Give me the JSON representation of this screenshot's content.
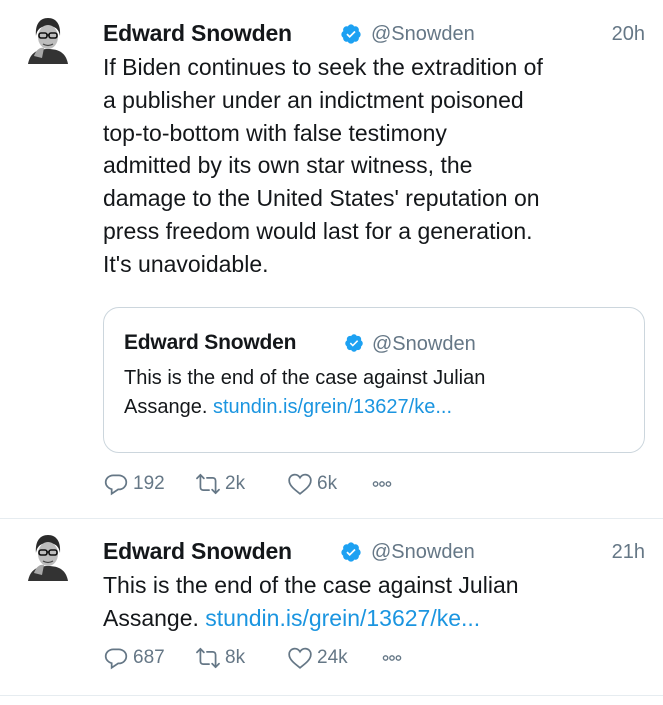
{
  "tweets": [
    {
      "author": "Edward Snowden",
      "handle": "@Snowden",
      "time": "20h",
      "text": "If Biden continues to seek the extradition of\na publisher under an indictment poisoned\ntop-to-bottom with false testimony\nadmitted by its own star witness, the\ndamage to the United States' reputation on\npress freedom would last for a generation.\nIt's unavoidable.",
      "quoted": {
        "author": "Edward Snowden",
        "handle": "@Snowden",
        "text": "This is the end of the case against Julian\nAssange. ",
        "link": "stundin.is/grein/13627/ke..."
      },
      "replies": "192",
      "retweets": "2k",
      "likes": "6k"
    },
    {
      "author": "Edward Snowden",
      "handle": "@Snowden",
      "time": "21h",
      "text": "This is the end of the case against Julian\nAssange. ",
      "link": "stundin.is/grein/13627/ke...",
      "replies": "687",
      "retweets": "8k",
      "likes": "24k"
    }
  ],
  "icons": {
    "reply": "reply-icon",
    "retweet": "retweet-icon",
    "like": "heart-icon",
    "more": "more-icon",
    "verified": "verified-badge-icon"
  },
  "colors": {
    "link": "#1b95e0",
    "verified": "#1da1f2",
    "secondary_text": "#657786",
    "border": "#ccd6dd"
  }
}
